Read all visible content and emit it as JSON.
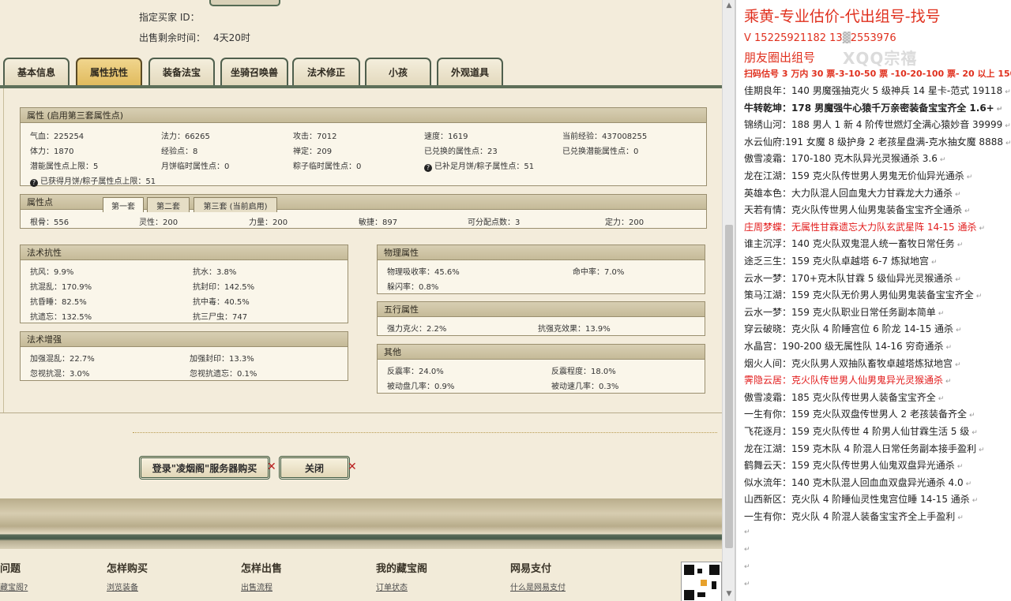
{
  "seller": {
    "buyer_id_label": "指定买家 ID：",
    "time_left_label": "出售剩余时间：",
    "time_left_value": "4天20时"
  },
  "tabs": [
    "基本信息",
    "属性抗性",
    "装备法宝",
    "坐骑召唤兽",
    "法术修正",
    "小孩",
    "外观道具"
  ],
  "active_tab": "属性抗性",
  "attr_panel": {
    "title": "属性 (启用第三套属性点)",
    "rows": [
      [
        "气血：225254",
        "法力：66265",
        "攻击：7012",
        "速度：1619",
        "当前经验：437008255"
      ],
      [
        "体力：1870",
        "经验点：8",
        "禅定：209",
        "已兑换的属性点：23",
        "已兑换潜能属性点：0"
      ],
      [
        "潜能属性点上限：5",
        "月饼临时属性点：0",
        "粽子临时属性点：0",
        "已补足月饼/粽子属性点：51",
        ""
      ]
    ],
    "note": "已获得月饼/粽子属性点上限：51"
  },
  "points_panel": {
    "title": "属性点",
    "subtabs": [
      "第一套",
      "第二套",
      "第三套 (当前启用)"
    ],
    "values": [
      "根骨：556",
      "灵性：200",
      "力量：200",
      "敏捷：897",
      "可分配点数：3",
      "定力：200"
    ]
  },
  "resist_panel": {
    "title": "法术抗性",
    "items": [
      [
        "抗风：9.9%",
        "抗水：3.8%"
      ],
      [
        "抗混乱：170.9%",
        "抗封印：142.5%"
      ],
      [
        "抗昏睡：82.5%",
        "抗中毒：40.5%"
      ],
      [
        "抗遗忘：132.5%",
        "抗三尸虫：747"
      ]
    ]
  },
  "boost_panel": {
    "title": "法术增强",
    "items": [
      [
        "加强混乱：22.7%",
        "加强封印：13.3%"
      ],
      [
        "忽视抗混：3.0%",
        "忽视抗遗忘：0.1%"
      ]
    ]
  },
  "phys_panel": {
    "title": "物理属性",
    "items": [
      [
        "物理吸收率：45.6%",
        "命中率：7.0%"
      ],
      [
        "躲闪率：0.8%",
        ""
      ]
    ]
  },
  "five_panel": {
    "title": "五行属性",
    "items": [
      [
        "强力克火：2.2%",
        "抗强克效果：13.9%"
      ]
    ]
  },
  "other_panel": {
    "title": "其他",
    "items": [
      [
        "反震率：24.0%",
        "反震程度：18.0%"
      ],
      [
        "被动盘几率：0.9%",
        "被动速几率：0.3%"
      ]
    ]
  },
  "buttons": {
    "buy": "登录\"凌烟阁\"服务器购买",
    "close": "关闭"
  },
  "footer": {
    "cols": [
      "问题",
      "怎样购买",
      "怎样出售",
      "我的藏宝阁",
      "网易支付"
    ],
    "links": [
      "藏宝阁?",
      "浏览装备",
      "出售流程",
      "订单状态",
      "什么是网易支付"
    ]
  },
  "chat": {
    "title": "乘黄-专业估价-代出组号-找号",
    "contact": "V    15225921182   13",
    "contact2": "2553976",
    "moments": "朋友圈出组号",
    "watermark": "XQQ宗禧",
    "price": "扫码估号 3 万内 30 票-3-10-50 票  -10-20-100 票- 20 以上 150",
    "lines": [
      {
        "t": "佳期良年：140 男魔强抽克火 5 级神兵 14 星卡-范式 19118",
        "c": "normal"
      },
      {
        "t": "牛转乾坤：178 男魔强牛心猿千万亲密装备宝宝齐全 1.6+",
        "c": "bold"
      },
      {
        "t": "锦绣山河：188 男人 1 新 4 阶传世燃灯全满心猿妙音 39999",
        "c": "normal"
      },
      {
        "t": "水云仙府:191 女魔 8 级护身 2 老孩星盘满-克水抽女魔 8888",
        "c": "normal"
      },
      {
        "t": "傲雪凌霜：170-180 克木队异光灵猴通杀 3.6",
        "c": "normal"
      },
      {
        "t": "龙在江湖：159 克火队传世男人男鬼无价仙异光通杀",
        "c": "normal"
      },
      {
        "t": "英雄本色：大力队混人回血鬼大力甘霖龙大力通杀",
        "c": "normal"
      },
      {
        "t": "天若有情：克火队传世男人仙男鬼装备宝宝齐全通杀",
        "c": "normal"
      },
      {
        "t": "庄周梦蝶：无属性甘霖遗忘大力队玄武星阵 14-15 通杀",
        "c": "red"
      },
      {
        "t": "谁主沉浮：140 克火队双鬼混人统一畜牧日常任务",
        "c": "normal"
      },
      {
        "t": "途乏三生：159 克火队卓越塔 6-7 炼狱地宫",
        "c": "normal"
      },
      {
        "t": "云水一梦：170+克木队甘霖 5 级仙异光灵猴通杀",
        "c": "normal"
      },
      {
        "t": "策马江湖：159 克火队无价男人男仙男鬼装备宝宝齐全",
        "c": "normal"
      },
      {
        "t": "云水一梦：159 克火队职业日常任务副本简单",
        "c": "normal"
      },
      {
        "t": "穿云破晓：克火队 4 阶睡宫位 6 阶龙 14-15 通杀",
        "c": "normal"
      },
      {
        "t": "水晶宫：190-200 级无属性队 14-16 穷奇通杀",
        "c": "normal"
      },
      {
        "t": "烟火人间：克火队男人双抽队畜牧卓越塔炼狱地宫",
        "c": "normal"
      },
      {
        "t": "霁隐云居：克火队传世男人仙男鬼异光灵猴通杀",
        "c": "red"
      },
      {
        "t": "傲雪凌霜：185 克火队传世男人装备宝宝齐全",
        "c": "normal"
      },
      {
        "t": "一生有你：159 克火队双盘传世男人 2 老孩装备齐全",
        "c": "normal"
      },
      {
        "t": "飞花逐月：159 克火队传世 4 阶男人仙甘霖生活 5 级",
        "c": "normal"
      },
      {
        "t": "龙在江湖：159 克木队 4 阶混人日常任务副本接手盈利",
        "c": "normal"
      },
      {
        "t": "鹤舞云天：159 克火队传世男人仙鬼双盘异光通杀",
        "c": "normal"
      },
      {
        "t": "似水流年：140 克木队混人回血血双盘异光通杀 4.0",
        "c": "normal"
      },
      {
        "t": "山西新区：克火队 4 阶睡仙灵性鬼宫位睡 14-15 通杀",
        "c": "normal"
      },
      {
        "t": "一生有你：克火队 4 阶混人装备宝宝齐全上手盈利",
        "c": "normal"
      }
    ]
  }
}
